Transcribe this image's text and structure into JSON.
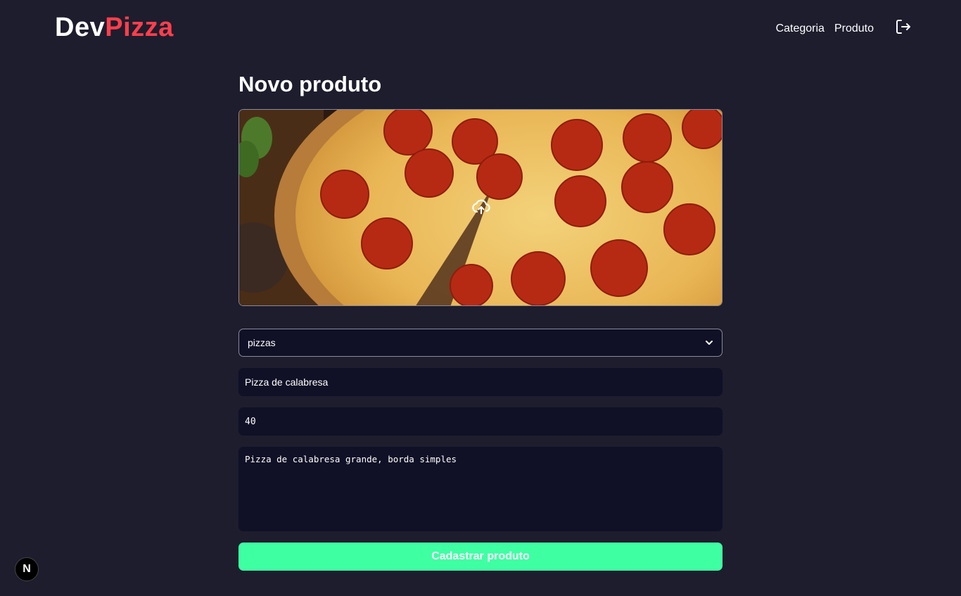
{
  "header": {
    "logo_part1": "Dev",
    "logo_part2": "Pizza",
    "nav": [
      {
        "label": "Categoria"
      },
      {
        "label": "Produto"
      }
    ],
    "logout_icon": "logout-icon"
  },
  "form": {
    "title": "Novo produto",
    "upload_icon": "cloud-upload-icon",
    "category_selected": "pizzas",
    "name_value": "Pizza de calabresa",
    "price_value": "40",
    "description_value": "Pizza de calabresa grande, borda simples",
    "submit_label": "Cadastrar produto"
  },
  "dev_badge": {
    "label": "N"
  },
  "colors": {
    "background": "#1d1d2e",
    "brand_red": "#ff3f4b",
    "input_bg": "#101026",
    "submit_green": "#3fffa3"
  }
}
